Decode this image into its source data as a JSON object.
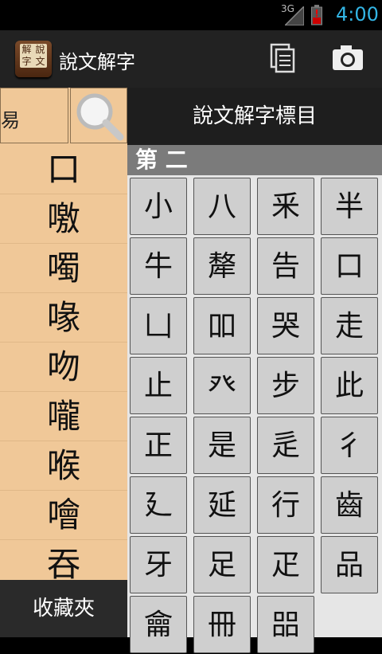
{
  "status": {
    "network": "3G",
    "time": "4:00"
  },
  "app": {
    "title": "說文解字",
    "icon_text": [
      "解",
      "說",
      "字",
      "文"
    ]
  },
  "actions": {
    "copy_icon": "copy-icon",
    "camera_icon": "camera-icon"
  },
  "search": {
    "value": "易"
  },
  "char_list": [
    "口",
    "噭",
    "噣",
    "喙",
    "吻",
    "嚨",
    "喉",
    "噲",
    "吞"
  ],
  "favorites_label": "收藏夾",
  "index": {
    "title": "說文解字標目",
    "section": "第 二",
    "radicals": [
      "小",
      "八",
      "釆",
      "半",
      "牛",
      "犛",
      "告",
      "口",
      "凵",
      "吅",
      "哭",
      "走",
      "止",
      "癶",
      "步",
      "此",
      "正",
      "是",
      "辵",
      "彳",
      "廴",
      "延",
      "行",
      "齒",
      "牙",
      "足",
      "疋",
      "品",
      "龠",
      "冊",
      "㗊"
    ]
  }
}
